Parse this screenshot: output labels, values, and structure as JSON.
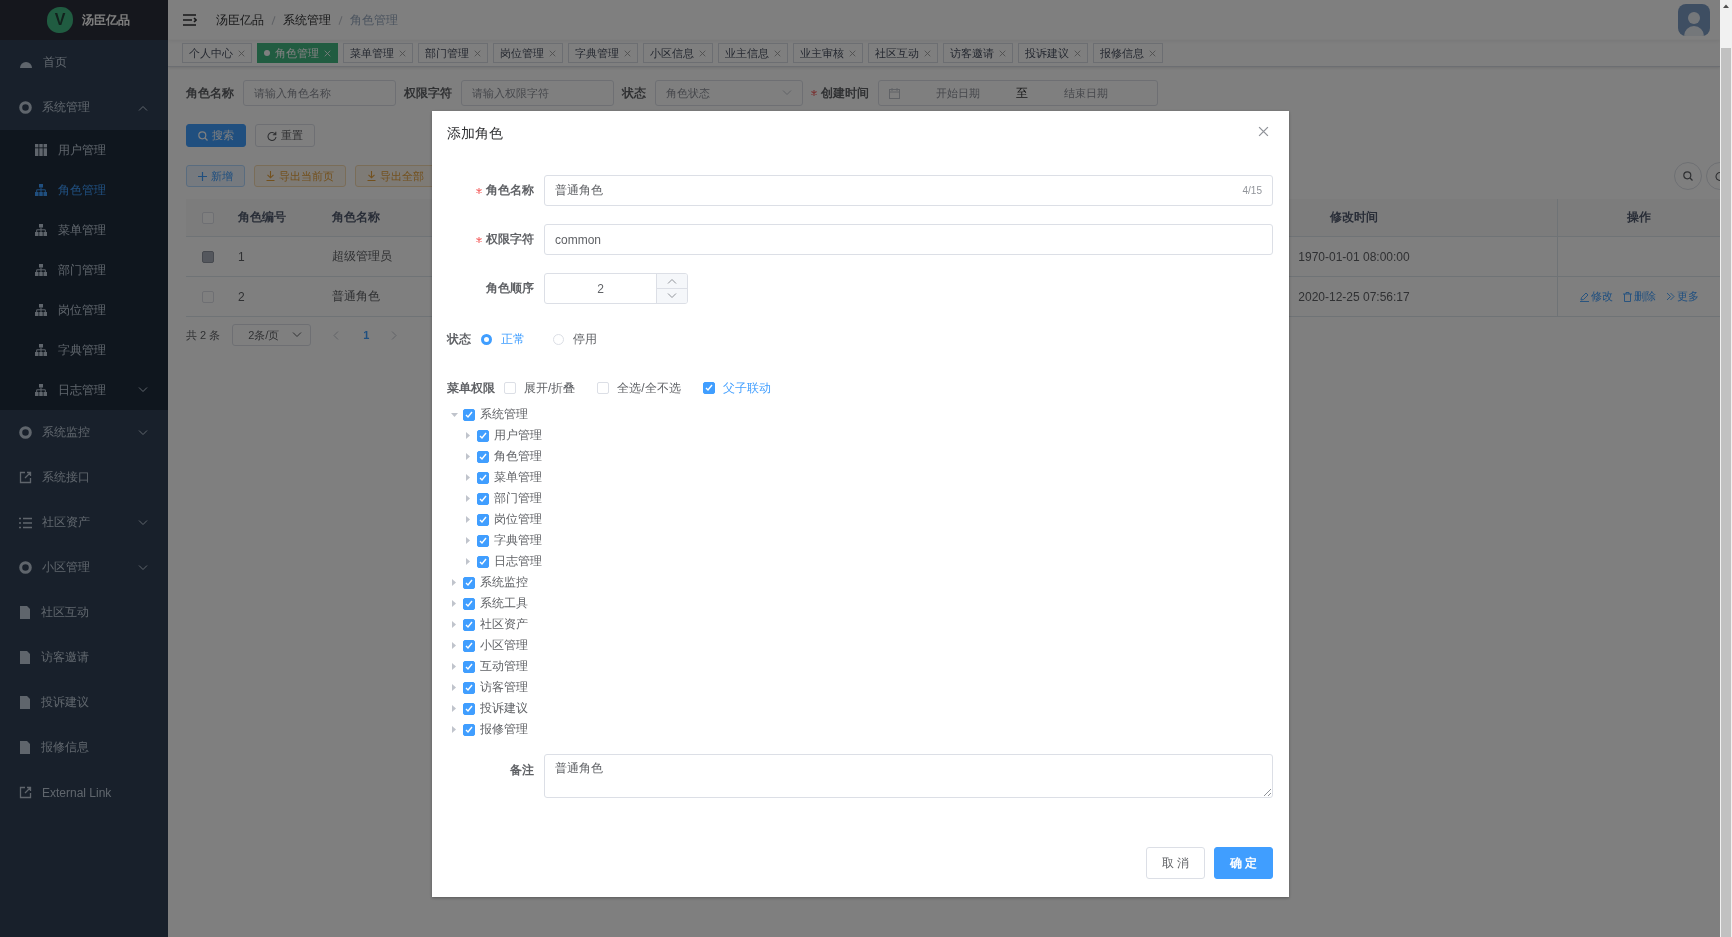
{
  "sidebar": {
    "logo_mark": "V",
    "title": "汤臣亿品",
    "items": [
      {
        "label": "首页",
        "kind": "link",
        "selected": false
      },
      {
        "label": "系统管理",
        "kind": "group",
        "expanded": true,
        "selected": false,
        "children": [
          {
            "label": "用户管理",
            "kind": "link",
            "selected": false
          },
          {
            "label": "角色管理",
            "kind": "link",
            "selected": true
          },
          {
            "label": "菜单管理",
            "kind": "link",
            "selected": false
          },
          {
            "label": "部门管理",
            "kind": "link",
            "selected": false
          },
          {
            "label": "岗位管理",
            "kind": "link",
            "selected": false
          },
          {
            "label": "字典管理",
            "kind": "link",
            "selected": false
          },
          {
            "label": "日志管理",
            "kind": "group",
            "expanded": false,
            "selected": false
          }
        ]
      },
      {
        "label": "系统监控",
        "kind": "group",
        "expanded": false,
        "selected": false
      },
      {
        "label": "系统接口",
        "kind": "link",
        "selected": false
      },
      {
        "label": "社区资产",
        "kind": "group",
        "expanded": false,
        "selected": false
      },
      {
        "label": "小区管理",
        "kind": "group",
        "expanded": false,
        "selected": false
      },
      {
        "label": "社区互动",
        "kind": "link",
        "selected": false
      },
      {
        "label": "访客邀请",
        "kind": "link",
        "selected": false
      },
      {
        "label": "投诉建议",
        "kind": "link",
        "selected": false
      },
      {
        "label": "报修信息",
        "kind": "link",
        "selected": false
      },
      {
        "label": "External Link",
        "kind": "link",
        "selected": false
      }
    ]
  },
  "navbar": {
    "breadcrumb": [
      "汤臣亿品",
      "系统管理",
      "角色管理"
    ]
  },
  "tabs": [
    {
      "label": "个人中心",
      "selected": false
    },
    {
      "label": "角色管理",
      "selected": true
    },
    {
      "label": "菜单管理",
      "selected": false
    },
    {
      "label": "部门管理",
      "selected": false
    },
    {
      "label": "岗位管理",
      "selected": false
    },
    {
      "label": "字典管理",
      "selected": false
    },
    {
      "label": "小区信息",
      "selected": false
    },
    {
      "label": "业主信息",
      "selected": false
    },
    {
      "label": "业主审核",
      "selected": false
    },
    {
      "label": "社区互动",
      "selected": false
    },
    {
      "label": "访客邀请",
      "selected": false
    },
    {
      "label": "投诉建议",
      "selected": false
    },
    {
      "label": "报修信息",
      "selected": false
    }
  ],
  "search": {
    "fields": [
      {
        "kind": "input",
        "label": "角色名称",
        "placeholder": "请输入角色名称"
      },
      {
        "kind": "input",
        "label": "权限字符",
        "placeholder": "请输入权限字符"
      },
      {
        "kind": "select",
        "label": "状态",
        "placeholder": "角色状态"
      },
      {
        "kind": "daterange",
        "label": "创建时间",
        "required": true,
        "start_placeholder": "开始日期",
        "separator": "至",
        "end_placeholder": "结束日期"
      }
    ],
    "buttons": [
      {
        "label": "搜索",
        "kind": "primary"
      },
      {
        "label": "重置",
        "kind": "default"
      }
    ]
  },
  "toolbar": {
    "buttons": [
      {
        "label": "新增",
        "kind": "primary-plain"
      },
      {
        "label": "导出当前页",
        "kind": "warning-plain"
      },
      {
        "label": "导出全部",
        "kind": "warning-plain"
      }
    ]
  },
  "table": {
    "all_checked": false,
    "columns": [
      "角色编号",
      "角色名称",
      "修改时间",
      "操作"
    ],
    "rows": [
      {
        "checked": false,
        "disabled": true,
        "cells": [
          "1",
          "超级管理员",
          "1970-01-01 08:00:00"
        ]
      },
      {
        "checked": false,
        "disabled": false,
        "cells": [
          "2",
          "普通角色",
          "2020-12-25 07:56:17"
        ],
        "actions": [
          {
            "label": "修改",
            "kind": "edit"
          },
          {
            "label": "删除",
            "kind": "delete"
          },
          {
            "label": "更多",
            "kind": "more"
          }
        ]
      }
    ]
  },
  "pagination": {
    "total": "共 2 条",
    "page_size": "2条/页",
    "pages": [
      {
        "label": "1",
        "selected": true
      }
    ]
  },
  "dialog": {
    "title": "添加角色",
    "name_field": {
      "label": "角色名称",
      "required": true,
      "value": "普通角色",
      "counter": "4/15"
    },
    "key_field": {
      "label": "权限字符",
      "required": true,
      "value": "common"
    },
    "order_field": {
      "label": "角色顺序",
      "value": "2"
    },
    "status": {
      "label": "状态",
      "options": [
        {
          "label": "正常",
          "selected": true
        },
        {
          "label": "停用",
          "selected": false
        }
      ]
    },
    "menu_permission": {
      "label": "菜单权限",
      "options": [
        {
          "label": "展开/折叠",
          "checked": false
        },
        {
          "label": "全选/全不选",
          "checked": false
        },
        {
          "label": "父子联动",
          "checked": true
        }
      ]
    },
    "menu_tree": [
      {
        "label": "系统管理",
        "checked": true,
        "expanded": true,
        "children": [
          {
            "label": "用户管理",
            "checked": true,
            "expanded": false
          },
          {
            "label": "角色管理",
            "checked": true,
            "expanded": false
          },
          {
            "label": "菜单管理",
            "checked": true,
            "expanded": false
          },
          {
            "label": "部门管理",
            "checked": true,
            "expanded": false
          },
          {
            "label": "岗位管理",
            "checked": true,
            "expanded": false
          },
          {
            "label": "字典管理",
            "checked": true,
            "expanded": false
          },
          {
            "label": "日志管理",
            "checked": true,
            "expanded": false
          }
        ]
      },
      {
        "label": "系统监控",
        "checked": true,
        "expanded": false
      },
      {
        "label": "系统工具",
        "checked": true,
        "expanded": false
      },
      {
        "label": "社区资产",
        "checked": true,
        "expanded": false
      },
      {
        "label": "小区管理",
        "checked": true,
        "expanded": false
      },
      {
        "label": "互动管理",
        "checked": true,
        "expanded": false
      },
      {
        "label": "访客管理",
        "checked": true,
        "expanded": false
      },
      {
        "label": "投诉建议",
        "checked": true,
        "expanded": false
      },
      {
        "label": "报修管理",
        "checked": true,
        "expanded": false
      }
    ],
    "remark": {
      "label": "备注",
      "value": "普通角色"
    },
    "buttons": [
      {
        "label": "取 消",
        "kind": "default"
      },
      {
        "label": "确 定",
        "kind": "primary"
      }
    ]
  }
}
